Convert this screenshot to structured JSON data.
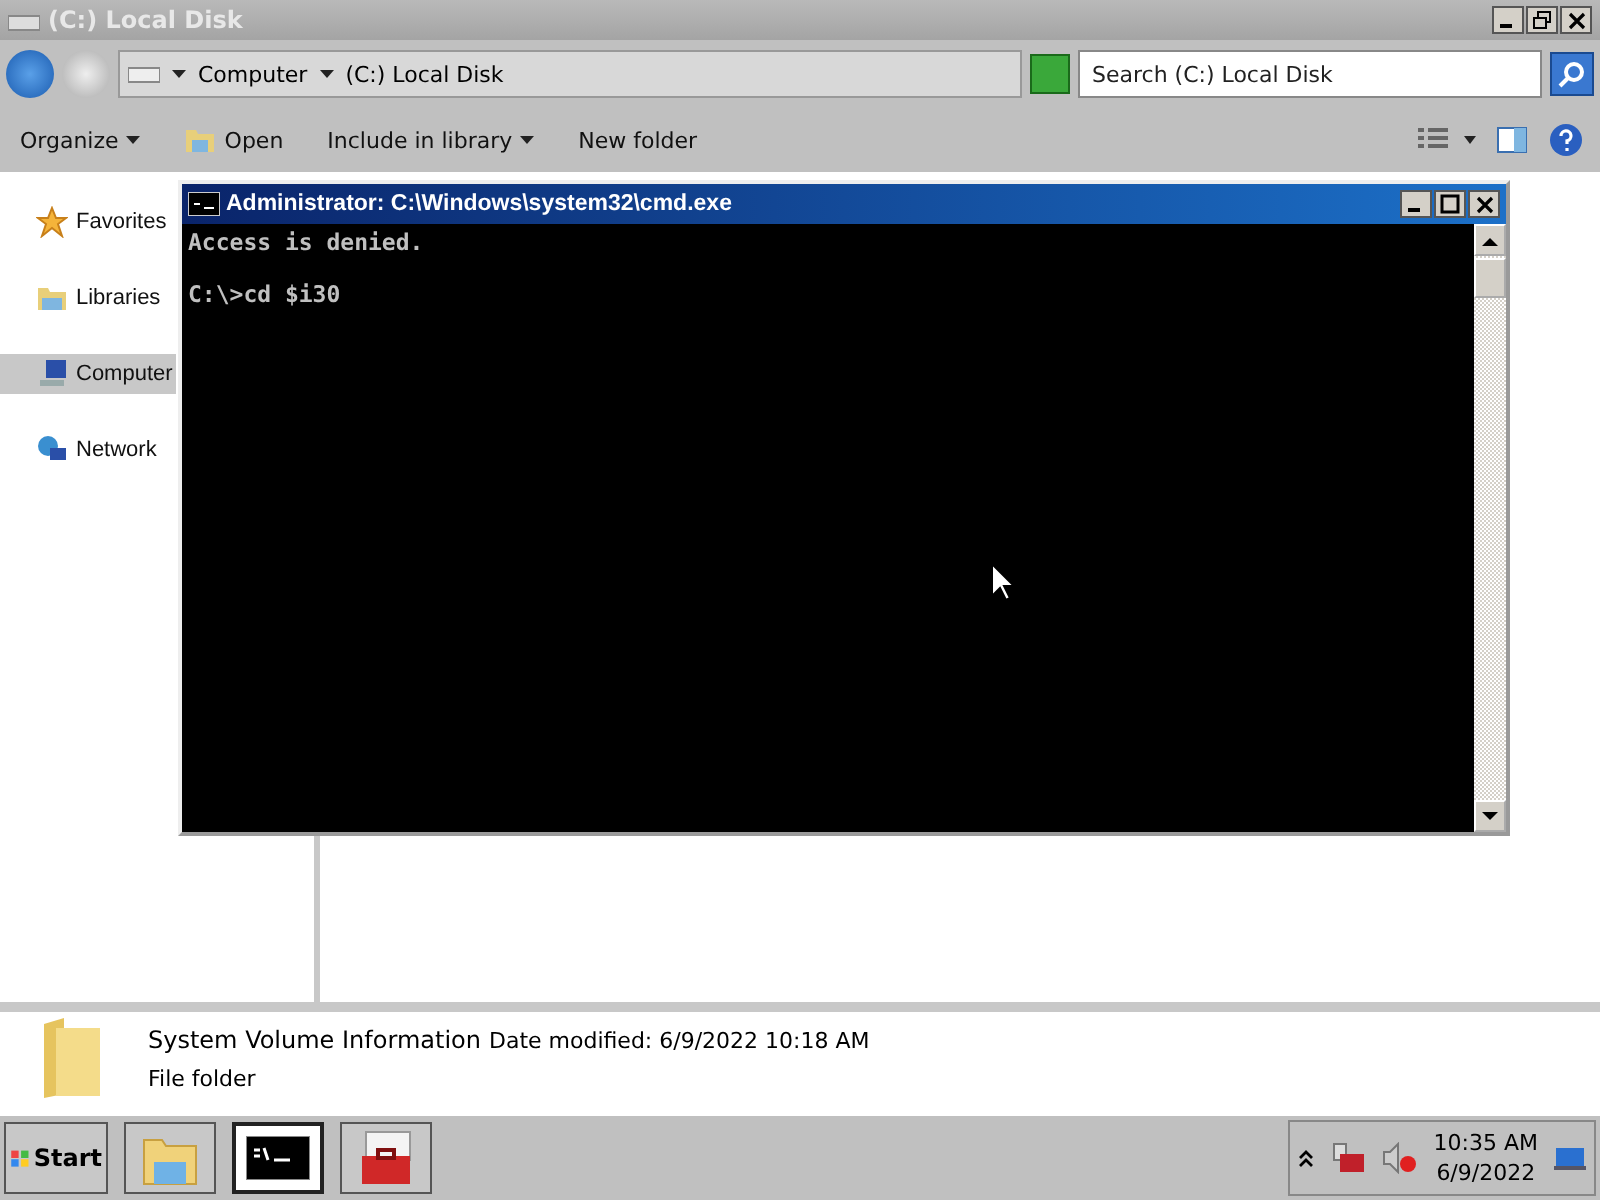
{
  "window": {
    "title": "(C:) Local Disk"
  },
  "address_bar": {
    "breadcrumbs": [
      "Computer",
      "(C:) Local Disk"
    ],
    "search": {
      "placeholder": "Search (C:) Local Disk"
    }
  },
  "toolbar": [
    {
      "kind": "menu",
      "label": "Organize"
    },
    {
      "kind": "open",
      "label": "Open"
    },
    {
      "kind": "menu",
      "label": "Include in library"
    },
    {
      "kind": "plain",
      "label": "New folder"
    }
  ],
  "sidebar": {
    "items": [
      {
        "kind": "favorites",
        "label": "Favorites",
        "selected": false
      },
      {
        "kind": "libraries",
        "label": "Libraries",
        "selected": false
      },
      {
        "kind": "computer",
        "label": "Computer",
        "selected": true
      },
      {
        "kind": "network",
        "label": "Network",
        "selected": false
      }
    ]
  },
  "console_window": {
    "title": "Administrator: C:\\Windows\\system32\\cmd.exe",
    "lines": [
      "Access is denied.",
      "C:\\>cd $i30"
    ]
  },
  "details_pane": {
    "name": "System Volume Information",
    "date_modified": "Date modified: 6/9/2022 10:18 AM",
    "type": "File folder"
  },
  "taskbar": {
    "start": "Start",
    "buttons": [
      {
        "kind": "explorer",
        "selected": false
      },
      {
        "kind": "console",
        "selected": true
      },
      {
        "kind": "toolbox",
        "selected": false
      }
    ],
    "clock": {
      "time": "10:35 AM",
      "date": "6/9/2022"
    }
  }
}
